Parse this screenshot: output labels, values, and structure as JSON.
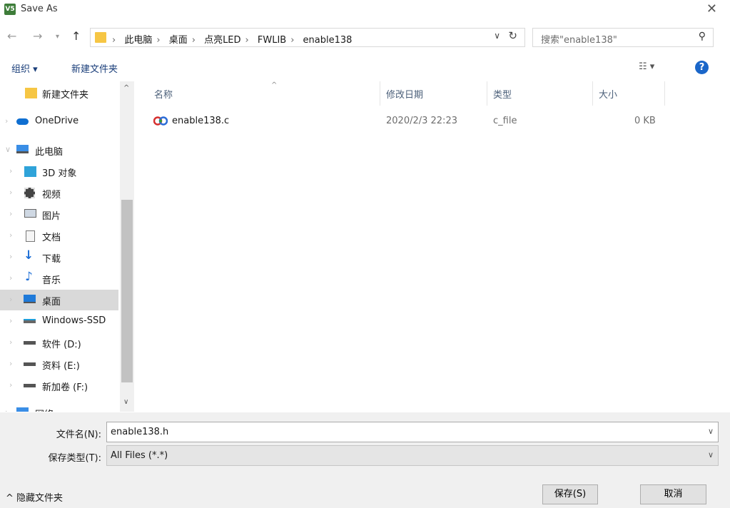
{
  "window": {
    "title": "Save As",
    "app_icon_text": "V5"
  },
  "nav": {
    "breadcrumbs": [
      "此电脑",
      "桌面",
      "点亮LED",
      "FWLIB",
      "enable138"
    ],
    "search_placeholder": "搜索\"enable138\""
  },
  "toolbar": {
    "organize": "组织 ▾",
    "new_folder": "新建文件夹"
  },
  "sidebar": {
    "items": [
      {
        "label": "新建文件夹",
        "icon": "folder-icon"
      },
      {
        "label": "OneDrive",
        "icon": "cloud-icon"
      },
      {
        "label": "此电脑",
        "icon": "computer-icon"
      },
      {
        "label": "3D 对象",
        "icon": "cube-icon"
      },
      {
        "label": "视频",
        "icon": "film-icon"
      },
      {
        "label": "图片",
        "icon": "picture-icon"
      },
      {
        "label": "文档",
        "icon": "document-icon"
      },
      {
        "label": "下载",
        "icon": "download-icon"
      },
      {
        "label": "音乐",
        "icon": "music-icon"
      },
      {
        "label": "桌面",
        "icon": "desktop-icon"
      },
      {
        "label": "Windows-SSD",
        "icon": "drive-icon"
      },
      {
        "label": "软件 (D:)",
        "icon": "drive-icon"
      },
      {
        "label": "资料 (E:)",
        "icon": "drive-icon"
      },
      {
        "label": "新加卷 (F:)",
        "icon": "drive-icon"
      },
      {
        "label": "网络",
        "icon": "network-icon"
      }
    ]
  },
  "filelist": {
    "columns": [
      "名称",
      "修改日期",
      "类型",
      "大小"
    ],
    "rows": [
      {
        "name": "enable138.c",
        "modified": "2020/2/3 22:23",
        "type": "c_file",
        "size": "0 KB"
      }
    ]
  },
  "form": {
    "filename_label": "文件名(N):",
    "filename_value": "enable138.h",
    "filetype_label": "保存类型(T):",
    "filetype_value": "All Files (*.*)"
  },
  "footer": {
    "hide_folders": "^ 隐藏文件夹",
    "save": "保存(S)",
    "cancel": "取消"
  },
  "colors": {
    "accent": "#1a66c9",
    "folder": "#f6c644",
    "selected": "#d9d9d9"
  }
}
